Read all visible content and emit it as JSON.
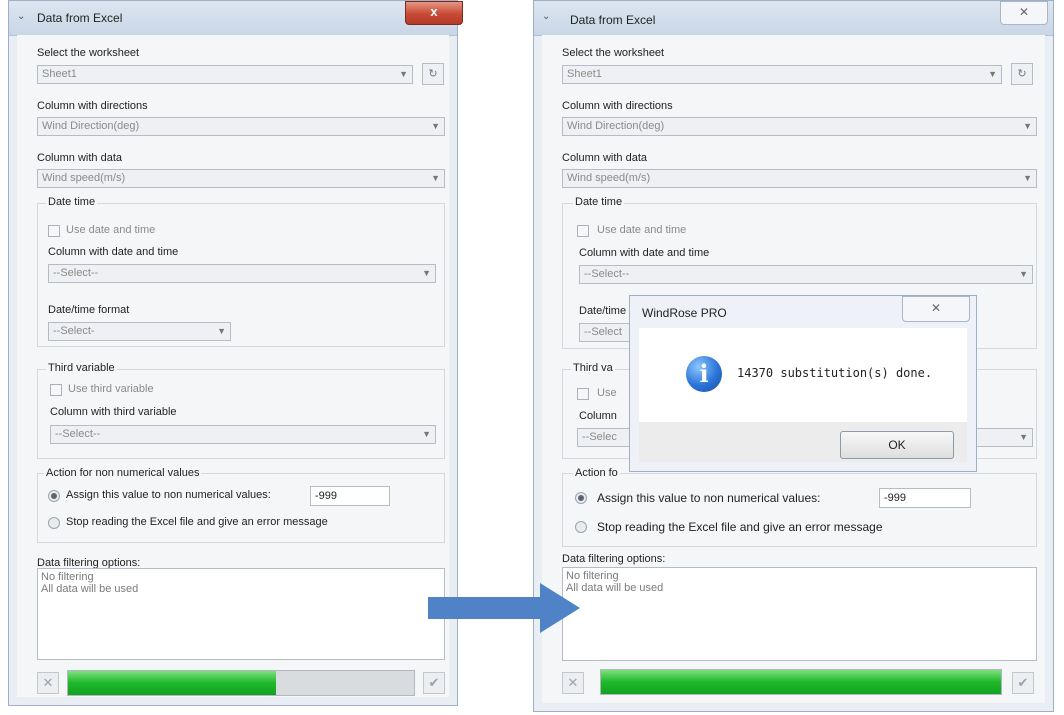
{
  "left_window": {
    "title": "Data from Excel",
    "close_glyph": "x",
    "worksheet_label": "Select the worksheet",
    "worksheet_value": "Sheet1",
    "directions_label": "Column with directions",
    "directions_value": "Wind Direction(deg)",
    "data_label": "Column with data",
    "data_value": "Wind speed(m/s)",
    "datetime_group": "Date time",
    "use_datetime": "Use date and time",
    "datetime_column_label": "Column with date and time",
    "datetime_column_value": "--Select--",
    "format_label": "Date/time format",
    "format_value": "--Select-",
    "third_group": "Third variable",
    "use_third": "Use third variable",
    "third_column_label": "Column with third variable",
    "third_column_value": "--Select--",
    "action_group": "Action for non numerical values",
    "assign_label": "Assign this value to non numerical values:",
    "assign_value": "-999",
    "stop_label": "Stop reading the Excel file and give an error message",
    "filter_label": "Data filtering options:",
    "filter_line1": "No filtering",
    "filter_line2": "All data will be used",
    "progress": 0.6
  },
  "right_window": {
    "title": "Data from Excel",
    "close_glyph": "✕",
    "worksheet_label": "Select the worksheet",
    "worksheet_value": "Sheet1",
    "directions_label": "Column with directions",
    "directions_value": "Wind Direction(deg)",
    "data_label": "Column with data",
    "data_value": "Wind speed(m/s)",
    "datetime_group": "Date time",
    "use_datetime": "Use date and time",
    "datetime_column_label": "Column with date and time",
    "datetime_column_value": "--Select--",
    "format_label_partial": "Date/time",
    "format_value_partial": "--Select",
    "third_group_partial": "Third va",
    "use_third_partial": "Use",
    "third_column_partial": "Column",
    "third_select_partial": "--Selec",
    "action_group_partial": "Action fo",
    "assign_label": "Assign this value to non numerical values:",
    "assign_value": "-999",
    "stop_label": "Stop reading the Excel file and give an error message",
    "filter_label": "Data filtering options:",
    "filter_line1": "No filtering",
    "filter_line2": "All data will be used",
    "progress": 1.0
  },
  "message_box": {
    "title": "WindRose PRO",
    "close_glyph": "✕",
    "message": "14370 substitution(s) done.",
    "ok_label": "OK",
    "icon": "info-icon"
  },
  "colors": {
    "progress_green": "#1fb82b",
    "close_red": "#c74a35",
    "arrow_blue": "#4f82c7"
  }
}
